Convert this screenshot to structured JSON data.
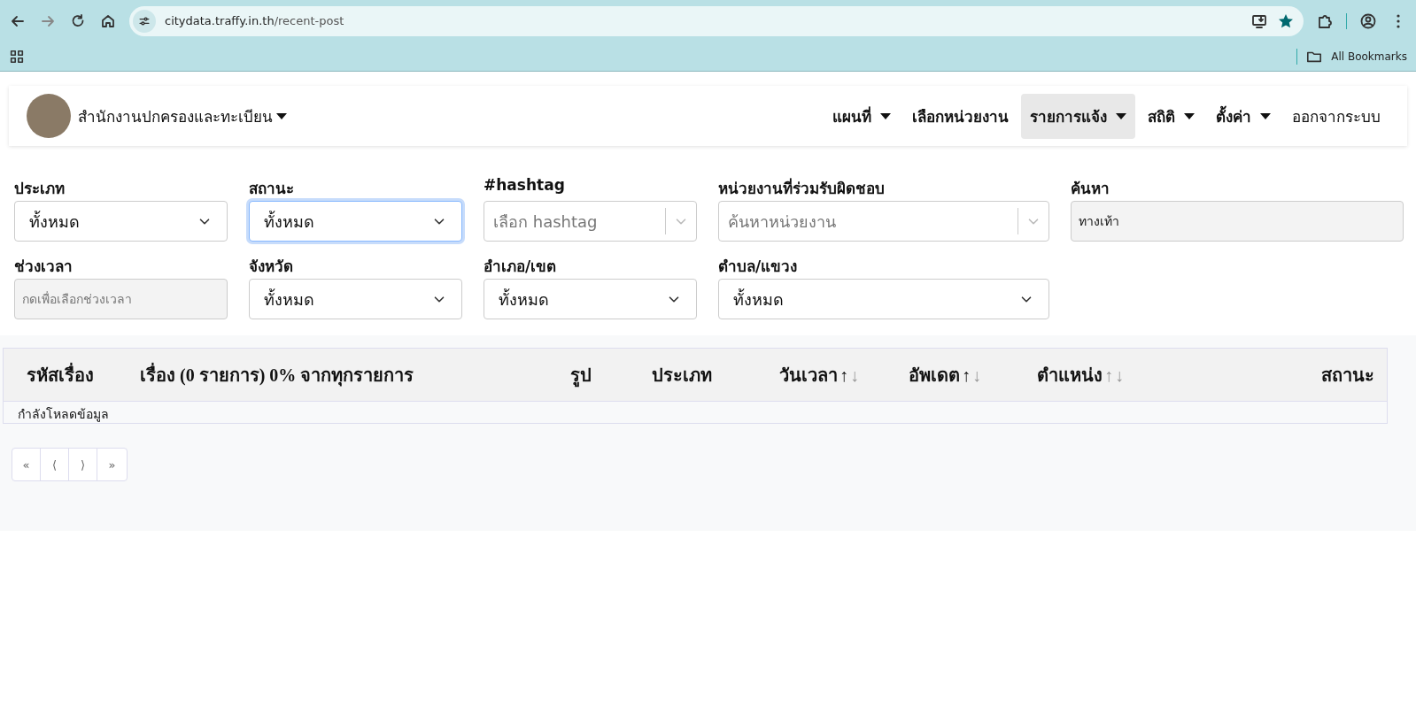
{
  "browser": {
    "url_host": "citydata.traffy.in.th",
    "url_path": "/recent-post",
    "bookmarks_label": "All Bookmarks"
  },
  "navbar": {
    "org_name": "สำนักงานปกครองและทะเบียน",
    "items": [
      {
        "label": "แผนที่",
        "caret": true,
        "selected": false
      },
      {
        "label": "เลือกหน่วยงาน",
        "caret": false,
        "selected": false
      },
      {
        "label": "รายการแจ้ง",
        "caret": true,
        "selected": true
      },
      {
        "label": "สถิติ",
        "caret": true,
        "selected": false
      },
      {
        "label": "ตั้งค่า",
        "caret": true,
        "selected": false
      },
      {
        "label": "ออกจากระบบ",
        "caret": false,
        "selected": false
      }
    ]
  },
  "filters": [
    {
      "label": "ประเภท",
      "kind": "select",
      "value": "ทั้งหมด",
      "focused": false
    },
    {
      "label": "สถานะ",
      "kind": "select",
      "value": "ทั้งหมด",
      "focused": true
    },
    {
      "label": "#hashtag",
      "kind": "combo",
      "placeholder": "เลือก hashtag",
      "focused": false
    },
    {
      "label": "หน่วยงานที่ร่วมรับผิดชอบ",
      "kind": "combo",
      "placeholder": "ค้นหาหน่วยงาน",
      "focused": false
    },
    {
      "label": "ค้นหา",
      "kind": "text",
      "value": "ทางเท้า",
      "focused": false
    },
    {
      "label": "ช่วงเวลา",
      "kind": "text",
      "placeholder": "กดเพื่อเลือกช่วงเวลา",
      "focused": false
    },
    {
      "label": "จังหวัด",
      "kind": "select",
      "value": "ทั้งหมด",
      "focused": false
    },
    {
      "label": "อำเภอ/เขต",
      "kind": "select",
      "value": "ทั้งหมด",
      "focused": false
    },
    {
      "label": "ตำบล/แขวง",
      "kind": "select",
      "value": "ทั้งหมด",
      "focused": false
    }
  ],
  "table": {
    "columns": [
      {
        "label": "รหัสเรื่อง"
      },
      {
        "label": "เรื่อง (0 รายการ) 0% จากทุกรายการ"
      },
      {
        "label": "รูป"
      },
      {
        "label": "ประเภท"
      },
      {
        "label": "วันเวลา",
        "up": "↑",
        "down": "↓",
        "sorted": true
      },
      {
        "label": "อัพเดต",
        "up": "↑",
        "down": "↓",
        "sorted": true
      },
      {
        "label": "ตำแหน่ง",
        "up": "↑",
        "down": "↓",
        "sorted": false
      },
      {
        "label": "สถานะ"
      }
    ],
    "status_text": "กำลังโหลดข้อมูล"
  },
  "pagination": [
    "«",
    "⟨",
    "⟩",
    "»"
  ]
}
